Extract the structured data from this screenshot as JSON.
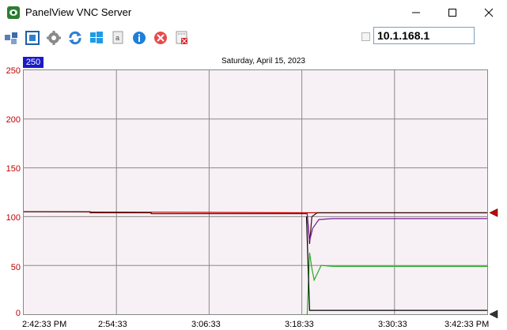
{
  "window": {
    "title": "PanelView VNC Server",
    "controls": [
      "minimize",
      "maximize",
      "close"
    ]
  },
  "toolbar": {
    "icons": [
      "connections-icon",
      "fullscreen-icon",
      "settings-icon",
      "refresh-icon",
      "windows-icon",
      "keyboard-icon",
      "info-icon",
      "disconnect-icon",
      "close-session-icon"
    ],
    "ip_address": "10.1.168.1"
  },
  "trend": {
    "scale_max_badge": "250",
    "date": "Saturday, April 15, 2023",
    "colors": {
      "plot_bg": "#f7f0f4",
      "grid": "#8a8a8a",
      "pen_red": "#cc0000",
      "pen_dark": "#3a1010",
      "pen_purple": "#7a1a9a",
      "pen_green": "#22b022",
      "pen_black": "#000000"
    },
    "y_axis": {
      "min": 0,
      "max": 250,
      "ticks": [
        "0",
        "50",
        "100",
        "150",
        "200",
        "250"
      ]
    },
    "x_axis": {
      "ticks": [
        "2:42:33 PM",
        "2:54:33",
        "3:06:33",
        "3:18:33",
        "3:30:33",
        "3:42:33 PM"
      ]
    }
  },
  "chart_data": {
    "type": "line",
    "title": "Saturday, April 15, 2023",
    "xlabel": "",
    "ylabel": "",
    "ylim": [
      0,
      250
    ],
    "x_ticks": [
      "2:42:33 PM",
      "2:54:33",
      "3:06:33",
      "3:18:33",
      "3:30:33",
      "3:42:33 PM"
    ],
    "grid": true,
    "series": [
      {
        "color": "#cc0000",
        "x_minutes": [
          0,
          36.7,
          60
        ],
        "values": [
          105,
          104,
          104
        ]
      },
      {
        "color": "#3a1010",
        "x_minutes": [
          0,
          8.6,
          8.6,
          16.5,
          16.5,
          34.4,
          34.4,
          36.7,
          37.0,
          37.3,
          38.0,
          60
        ],
        "values": [
          105,
          105,
          104,
          104,
          103,
          103,
          103,
          103,
          72,
          100,
          104,
          104
        ]
      },
      {
        "color": "#7a1a9a",
        "x_minutes": [
          36.7,
          37.0,
          37.4,
          38.2,
          40,
          60
        ],
        "values": [
          103,
          75,
          88,
          97,
          98,
          98
        ]
      },
      {
        "color": "#22b022",
        "x_minutes": [
          36.6,
          36.7,
          37.0,
          37.3,
          37.6,
          38.5,
          40,
          60
        ],
        "values": [
          0,
          0,
          63,
          47,
          35,
          50,
          49,
          49
        ]
      },
      {
        "color": "#000000",
        "x_minutes": [
          36.6,
          37.0,
          60
        ],
        "values": [
          100,
          4,
          4
        ]
      }
    ],
    "pen_markers": [
      {
        "color": "#cc0000",
        "value": 104
      },
      {
        "color": "#333333",
        "value": 0
      }
    ]
  }
}
